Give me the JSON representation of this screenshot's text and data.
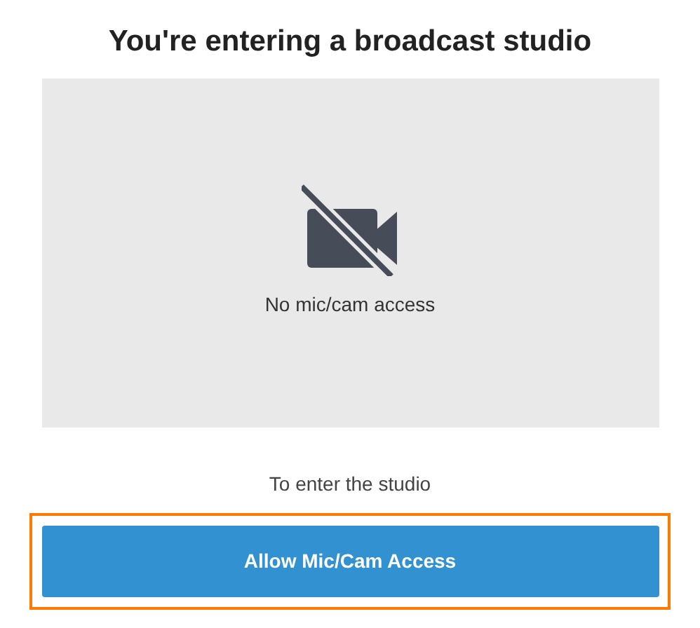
{
  "title": "You're entering a broadcast studio",
  "preview": {
    "status": "No mic/cam access"
  },
  "prompt": "To enter the studio",
  "button": {
    "label": "Allow Mic/Cam Access",
    "focused": true
  }
}
